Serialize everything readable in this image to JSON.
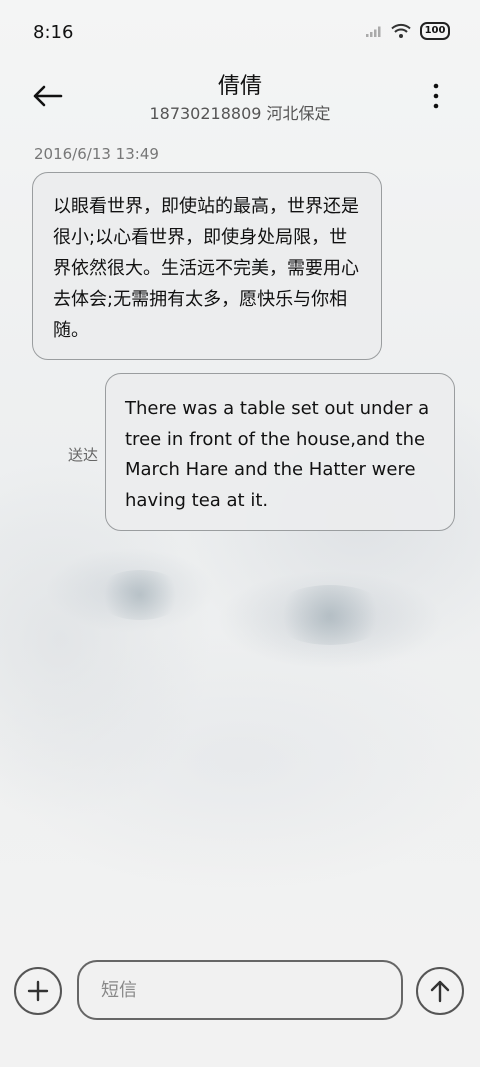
{
  "status_bar": {
    "time": "8:16",
    "battery": "100",
    "signal_icon": "cellular-signal-icon",
    "wifi_icon": "wifi-icon",
    "battery_icon": "battery-icon"
  },
  "header": {
    "contact_name": "倩倩",
    "contact_detail": "18730218809 河北保定",
    "back_icon": "arrow-left-icon",
    "more_icon": "more-vertical-icon"
  },
  "conversation": {
    "timestamp": "2016/6/13 13:49",
    "messages": [
      {
        "direction": "incoming",
        "text": "以眼看世界，即使站的最高，世界还是很小;以心看世界，即使身处局限，世界依然很大。生活远不完美，需要用心去体会;无需拥有太多，愿快乐与你相随。"
      },
      {
        "direction": "outgoing",
        "text": "There was a table set out under a tree in front of the house,and the March Hare and the Hatter were having tea at it.",
        "status": "送达"
      }
    ]
  },
  "composer": {
    "placeholder": "短信",
    "value": "",
    "add_icon": "plus-circle-icon",
    "send_icon": "arrow-up-circle-icon"
  },
  "colors": {
    "bubble_fill": "#ecedee",
    "bubble_border": "#9a9d9f",
    "text": "#111111",
    "secondary_text": "#777777"
  }
}
